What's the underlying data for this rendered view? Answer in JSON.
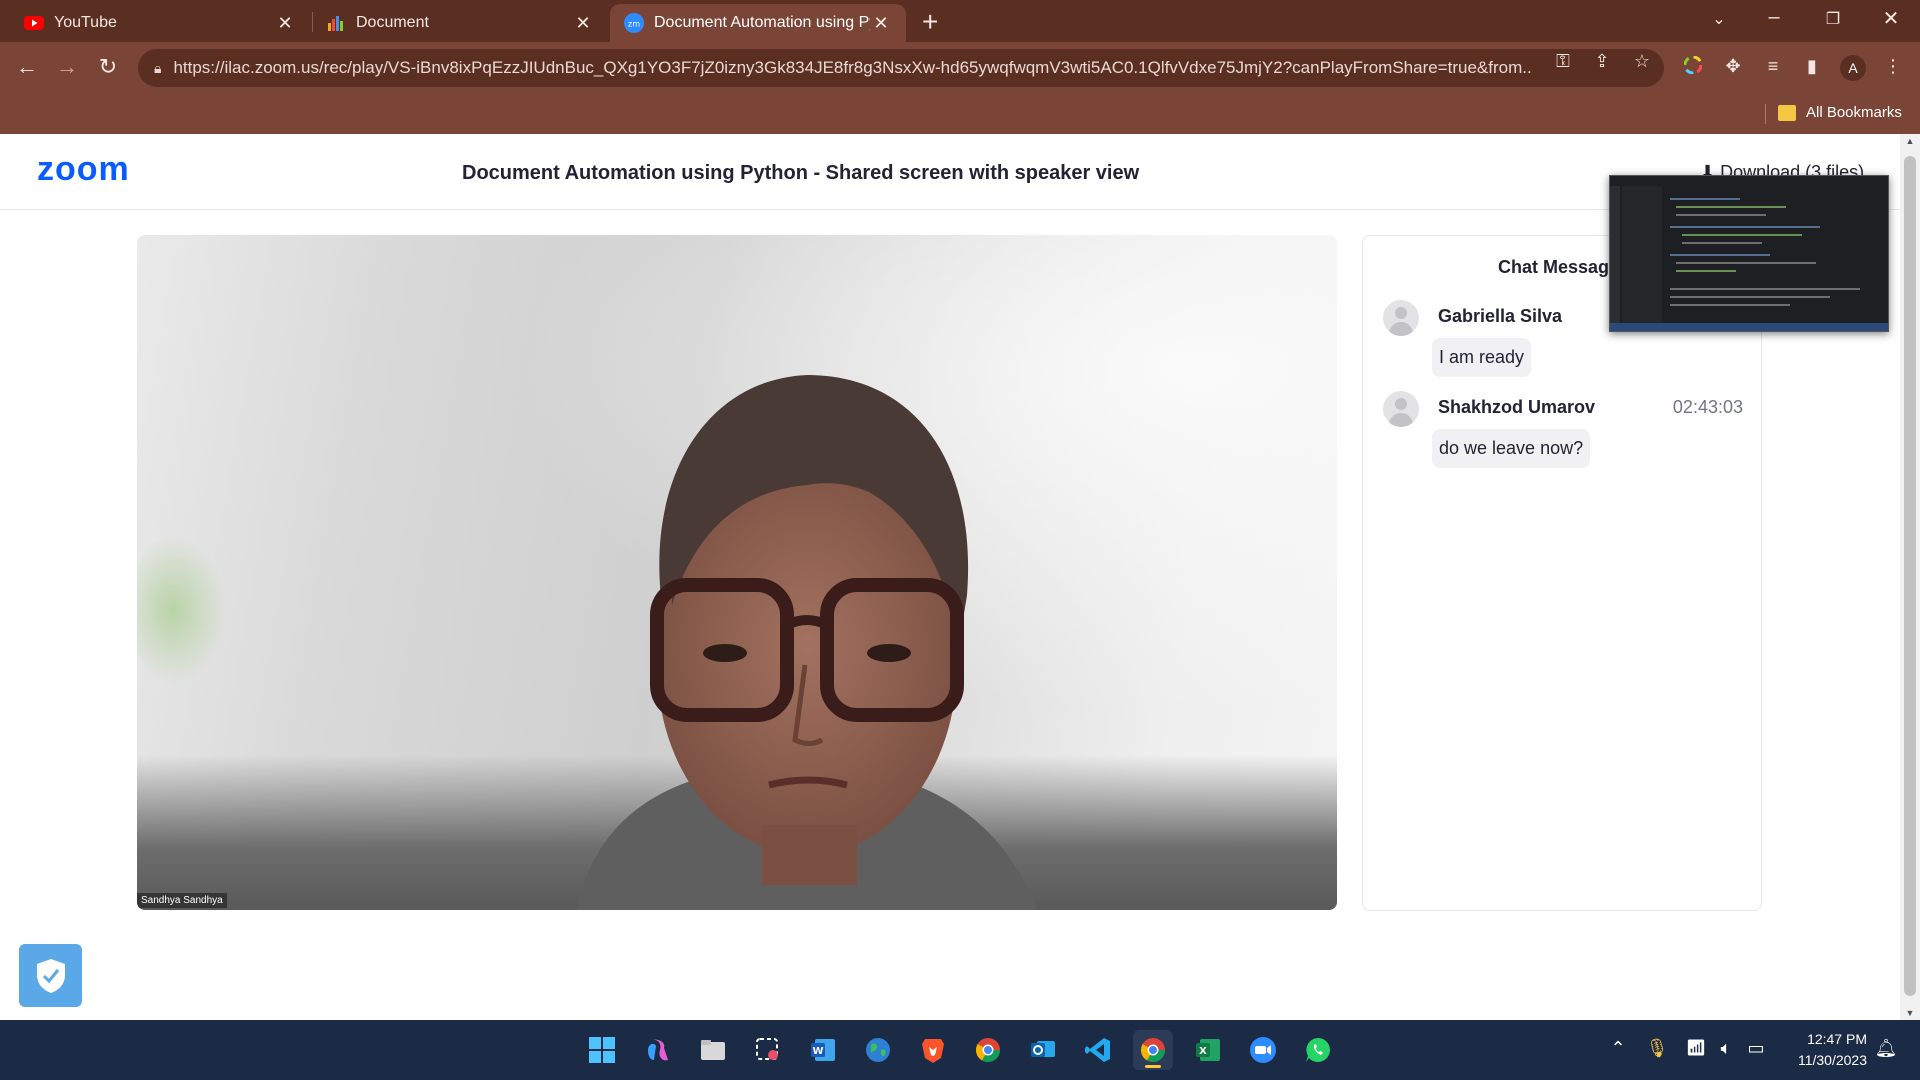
{
  "browser": {
    "tabs": [
      {
        "title": "YouTube",
        "icon": "youtube-icon"
      },
      {
        "title": "Document",
        "icon": "chart-bars-icon"
      },
      {
        "title": "Document Automation using Py",
        "icon": "zoom-icon"
      }
    ],
    "active_tab": 2,
    "zoom_favicon_text": "zm",
    "url": "https://ilac.zoom.us/rec/play/VS-iBnv8ixPqEzzJIUdnBuc_QXg1YO3F7jZ0izny3Gk834JE8fr8g3NsxXw-hd65ywqfwqmV3wti5AC0.1QlfvVdxe75JmjY2?canPlayFromShare=true&from...",
    "profile_initial": "A",
    "bookmarks_label": "All Bookmarks"
  },
  "zoom": {
    "logo": "zoom",
    "recording_title": "Document Automation using Python - Shared screen with speaker view",
    "download_label": "Download (3 files)",
    "speaker_name": "Sandhya Sandhya",
    "chat": {
      "title": "Chat Messages",
      "messages": [
        {
          "sender": "Gabriella Silva",
          "time": "",
          "text": "I am ready"
        },
        {
          "sender": "Shakhzod Umarov",
          "time": "02:43:03",
          "text": "do we leave now?"
        }
      ]
    }
  },
  "taskbar": {
    "apps": [
      "windows-start",
      "copilot",
      "file-explorer",
      "snipping-tool",
      "word",
      "earth",
      "brave",
      "chrome",
      "outlook",
      "vscode",
      "chrome-profile",
      "excel",
      "zoom",
      "whatsapp"
    ],
    "clock": {
      "time": "12:47 PM",
      "date": "11/30/2023"
    }
  },
  "colors": {
    "titlebar": "#5b2e22",
    "toolbar": "#7a4436",
    "zoom_blue": "#0b5cff",
    "taskbar": "#1b2a45"
  }
}
